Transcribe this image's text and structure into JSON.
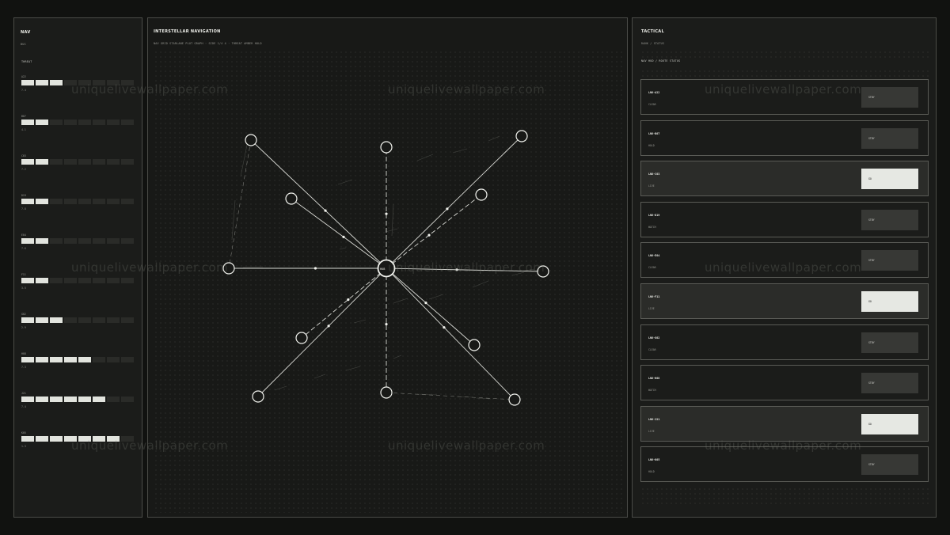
{
  "left": {
    "title": "NAV",
    "sub": "BUS",
    "section": "THREAT",
    "stats": [
      {
        "code": "A22",
        "level": 3,
        "value": "7.4"
      },
      {
        "code": "B07",
        "level": 2,
        "value": "4.1"
      },
      {
        "code": "C03",
        "level": 2,
        "value": "7.2"
      },
      {
        "code": "D19",
        "level": 2,
        "value": "7.8"
      },
      {
        "code": "E04",
        "level": 2,
        "value": "7.6"
      },
      {
        "code": "F11",
        "level": 2,
        "value": "3.5"
      },
      {
        "code": "G02",
        "level": 3,
        "value": "2.9"
      },
      {
        "code": "H08",
        "level": 5,
        "value": "7.3"
      },
      {
        "code": "J21",
        "level": 6,
        "value": "7.4"
      },
      {
        "code": "K05",
        "level": 7,
        "value": "1.3"
      }
    ]
  },
  "center": {
    "title": "INTERSTELLAR NAVIGATION",
    "subtitle": "NAV GRID STARLANE PLOT GRAPH · SIDE 1/4 4 · THREAT AMBER HOLD",
    "hub_label": "HUB"
  },
  "right": {
    "title": "TACTICAL",
    "sub": "RANK / STATUS",
    "section": "NAV HUD / ROUTE STATUS",
    "routes": [
      {
        "id": "LNK-A22",
        "status": "CLEAR",
        "action": "STBY",
        "selected": false
      },
      {
        "id": "LNK-B07",
        "status": "HOLD",
        "action": "STBY",
        "selected": false
      },
      {
        "id": "LNK-C03",
        "status": "LIVE",
        "action": "GO",
        "selected": true
      },
      {
        "id": "LNK-D19",
        "status": "WATCH",
        "action": "STBY",
        "selected": false
      },
      {
        "id": "LNK-E04",
        "status": "CLEAR",
        "action": "STBY",
        "selected": false
      },
      {
        "id": "LNK-F11",
        "status": "LIVE",
        "action": "GO",
        "selected": true
      },
      {
        "id": "LNK-G02",
        "status": "CLEAR",
        "action": "STBY",
        "selected": false
      },
      {
        "id": "LNK-H08",
        "status": "WATCH",
        "action": "STBY",
        "selected": false
      },
      {
        "id": "LNK-J21",
        "status": "LIVE",
        "action": "GO",
        "selected": true
      },
      {
        "id": "LNK-K05",
        "status": "HOLD",
        "action": "STBY",
        "selected": false
      }
    ]
  },
  "watermark": "uniquelivewallpaper.com"
}
